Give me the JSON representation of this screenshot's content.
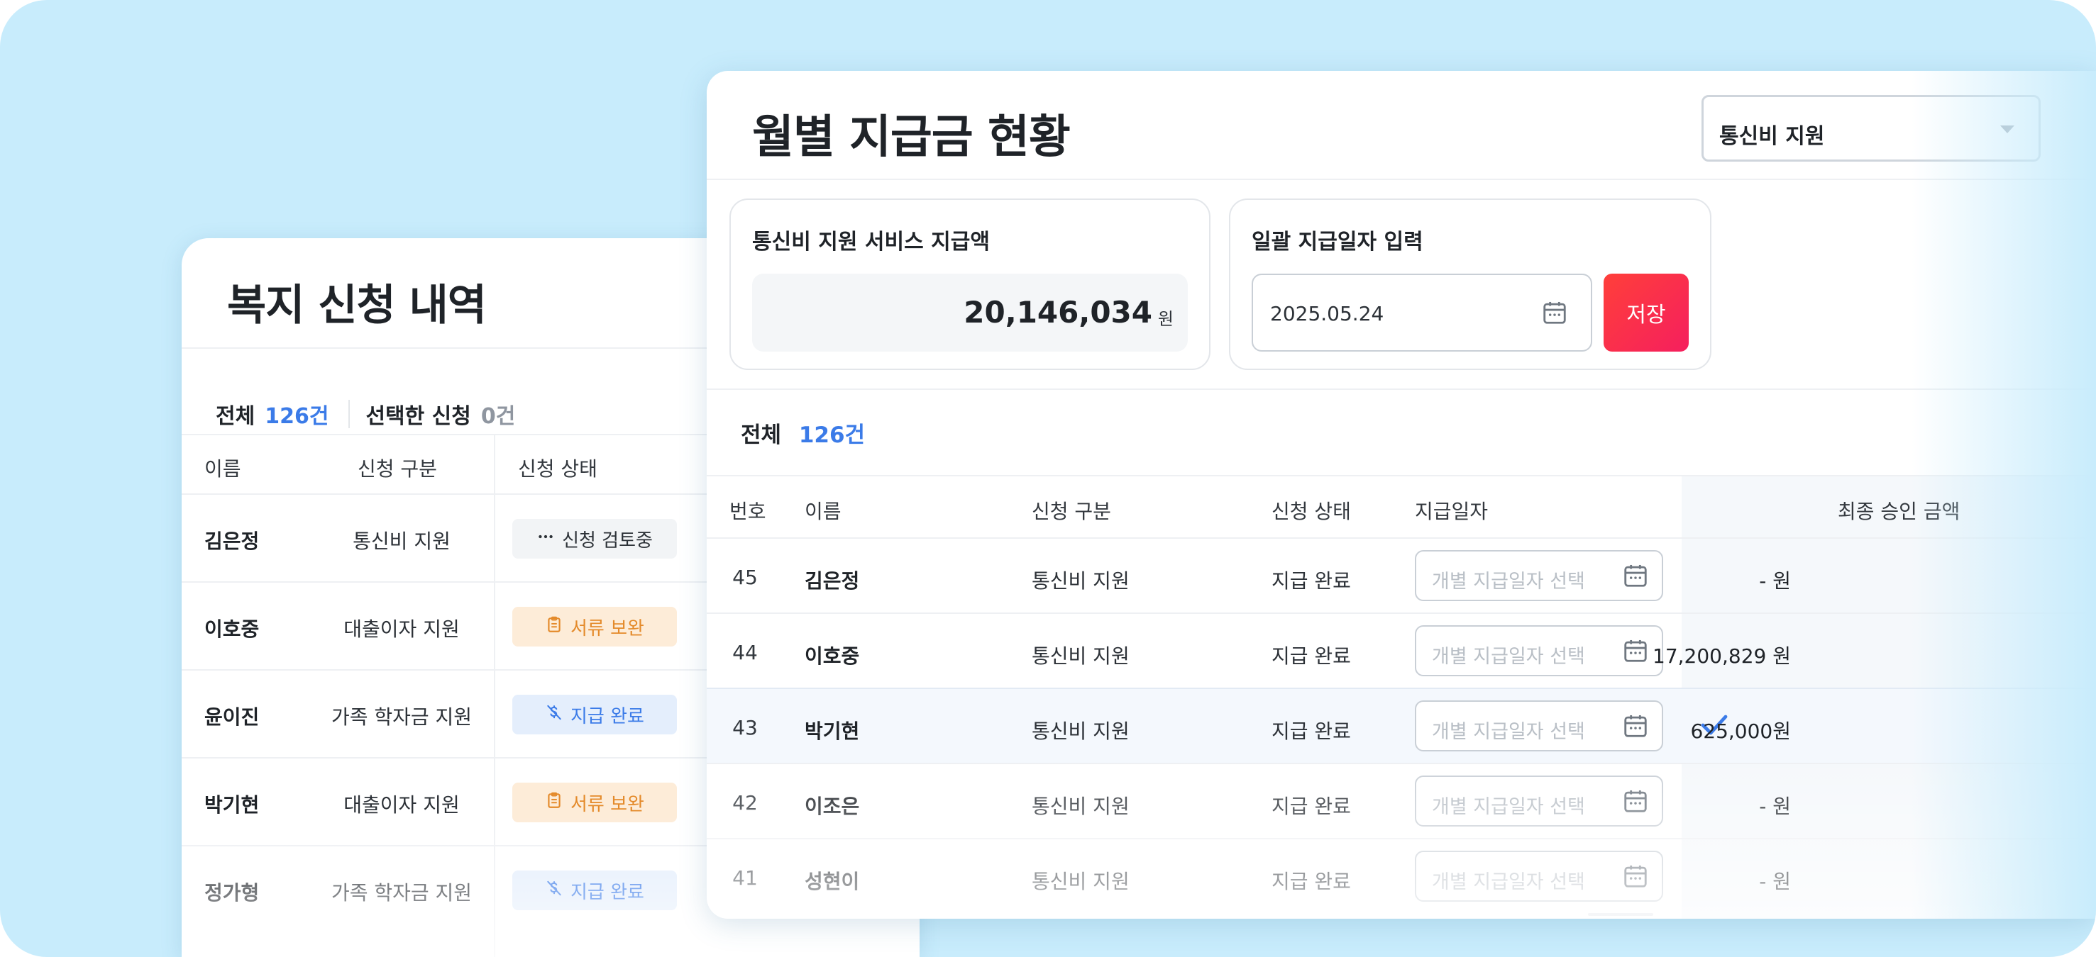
{
  "back_panel": {
    "title": "복지 신청 내역",
    "total_label": "전체",
    "total_count": "126건",
    "selected_label": "선택한 신청",
    "selected_count": "0건",
    "columns": [
      "이름",
      "신청 구분",
      "신청 상태"
    ],
    "rows": [
      {
        "name": "김은정",
        "category": "통신비 지원",
        "status": "신청 검토중",
        "status_type": "review",
        "status_icon": "more-dots-icon"
      },
      {
        "name": "이호중",
        "category": "대출이자 지원",
        "status": "서류 보완",
        "status_type": "docs",
        "status_icon": "clipboard-icon"
      },
      {
        "name": "윤이진",
        "category": "가족 학자금 지원",
        "status": "지급 완료",
        "status_type": "paid",
        "status_icon": "money-off-icon"
      },
      {
        "name": "박기현",
        "category": "대출이자 지원",
        "status": "서류 보완",
        "status_type": "docs",
        "status_icon": "clipboard-icon"
      },
      {
        "name": "정가형",
        "category": "가족 학자금 지원",
        "status": "지급 완료",
        "status_type": "paid",
        "status_icon": "money-off-icon"
      }
    ]
  },
  "front_panel": {
    "title": "월별 지급금 현황",
    "service_select": "통신비 지원",
    "amount_box": {
      "label": "통신비 지원 서비스 지급액",
      "amount": "20,146,034",
      "unit": "원"
    },
    "date_box": {
      "label": "일괄 지급일자 입력",
      "date": "2025.05.24",
      "save_label": "저장"
    },
    "total_label": "전체",
    "total_count": "126건",
    "columns": [
      "번호",
      "이름",
      "신청 구분",
      "신청 상태",
      "지급일자",
      "최종 승인 금액"
    ],
    "date_placeholder": "개별 지급일자 선택",
    "rows": [
      {
        "no": "45",
        "name": "김은정",
        "category": "통신비 지원",
        "status": "지급 완료",
        "amount": "- 원",
        "checked": false
      },
      {
        "no": "44",
        "name": "이호중",
        "category": "통신비 지원",
        "status": "지급 완료",
        "amount": "17,200,829 원",
        "checked": false
      },
      {
        "no": "43",
        "name": "박기현",
        "category": "통신비 지원",
        "status": "지급 완료",
        "amount": "625,000원",
        "checked": true
      },
      {
        "no": "42",
        "name": "이조은",
        "category": "통신비 지원",
        "status": "지급 완료",
        "amount": "- 원",
        "checked": false
      },
      {
        "no": "41",
        "name": "성현이",
        "category": "통신비 지원",
        "status": "지급 완료",
        "amount": "- 원",
        "checked": false
      }
    ]
  },
  "colors": {
    "background": "#c8ecfc",
    "accent_blue": "#3b7be8",
    "save_red": "#fa2e4a",
    "docs_orange": "#e48a2a"
  }
}
